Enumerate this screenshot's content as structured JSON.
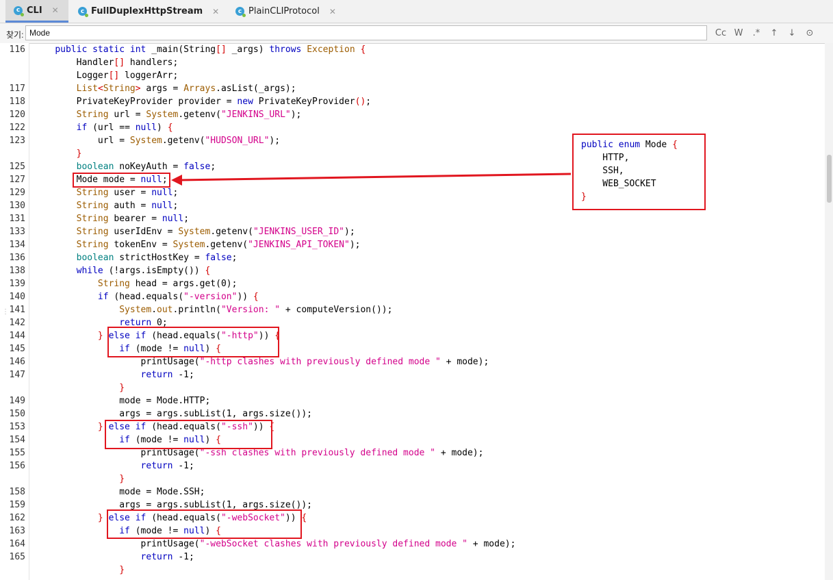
{
  "tabs": [
    {
      "label": "CLI",
      "active": true
    },
    {
      "label": "FullDuplexHttpStream",
      "active": false
    },
    {
      "label": "PlainCLIProtocol",
      "active": false
    }
  ],
  "find": {
    "label": "찾기:",
    "value": "Mode",
    "options": [
      "Cc",
      "W",
      ".*",
      "↑",
      "↓",
      "⊙"
    ]
  },
  "code_lines": [
    {
      "n": "116",
      "html": "    <span class='kw'>public static int</span> _main(String<span class='br'>[]</span> _args) <span class='kw'>throws</span> <span class='cls'>Exception</span> <span class='br'>{</span>"
    },
    {
      "n": "",
      "html": "        Handler<span class='br'>[]</span> handlers;"
    },
    {
      "n": "",
      "html": "        Logger<span class='br'>[]</span> loggerArr;"
    },
    {
      "n": "117",
      "html": "        <span class='cls'>List</span><span class='br'>&lt;</span><span class='cls'>String</span><span class='br'>&gt;</span> args = <span class='cls'>Arrays</span>.asList(_args);"
    },
    {
      "n": "118",
      "html": "        PrivateKeyProvider provider = <span class='kw'>new</span> PrivateKeyProvider<span class='br'>()</span>;"
    },
    {
      "n": "120",
      "html": "        <span class='cls'>String</span> url = <span class='cls'>System</span>.getenv(<span class='str'>\"JENKINS_URL\"</span>);"
    },
    {
      "n": "122",
      "html": "        <span class='kw'>if</span> (url == <span class='kw'>null</span>) <span class='br'>{</span>"
    },
    {
      "n": "123",
      "html": "            url = <span class='cls'>System</span>.getenv(<span class='str'>\"HUDSON_URL\"</span>);"
    },
    {
      "n": "",
      "html": "        <span class='br'>}</span>"
    },
    {
      "n": "125",
      "html": "        <span class='ty'>boolean</span> noKeyAuth = <span class='kw'>false</span>;"
    },
    {
      "n": "127",
      "html": "        Mode mode = <span class='kw'>null</span>;"
    },
    {
      "n": "129",
      "html": "        <span class='cls'>String</span> user = <span class='kw'>null</span>;"
    },
    {
      "n": "130",
      "html": "        <span class='cls'>String</span> auth = <span class='kw'>null</span>;"
    },
    {
      "n": "131",
      "html": "        <span class='cls'>String</span> bearer = <span class='kw'>null</span>;"
    },
    {
      "n": "133",
      "html": "        <span class='cls'>String</span> userIdEnv = <span class='cls'>System</span>.getenv(<span class='str'>\"JENKINS_USER_ID\"</span>);"
    },
    {
      "n": "134",
      "html": "        <span class='cls'>String</span> tokenEnv = <span class='cls'>System</span>.getenv(<span class='str'>\"JENKINS_API_TOKEN\"</span>);"
    },
    {
      "n": "136",
      "html": "        <span class='ty'>boolean</span> strictHostKey = <span class='kw'>false</span>;"
    },
    {
      "n": "138",
      "html": "        <span class='kw'>while</span> (!args.isEmpty()) <span class='br'>{</span>"
    },
    {
      "n": "139",
      "html": "            <span class='cls'>String</span> head = args.get(0);"
    },
    {
      "n": "140",
      "html": "            <span class='kw'>if</span> (head.equals(<span class='str'>\"-version\"</span>)) <span class='br'>{</span>"
    },
    {
      "n": "141",
      "html": "                <span class='cls'>System</span>.<span class='cls'>out</span>.println(<span class='str'>\"Version: \"</span> + computeVersion());"
    },
    {
      "n": "142",
      "html": "                <span class='kw'>return</span> 0;"
    },
    {
      "n": "144",
      "html": "            <span class='br'>}</span> <span class='kw'>else if</span> (head.equals(<span class='str'>\"-http\"</span>)) <span class='br'>{</span>"
    },
    {
      "n": "145",
      "html": "                <span class='kw'>if</span> (mode != <span class='kw'>null</span>) <span class='br'>{</span>"
    },
    {
      "n": "146",
      "html": "                    printUsage(<span class='str'>\"-http clashes with previously defined mode \"</span> + mode);"
    },
    {
      "n": "147",
      "html": "                    <span class='kw'>return</span> -1;"
    },
    {
      "n": "",
      "html": "                <span class='br'>}</span>"
    },
    {
      "n": "149",
      "html": "                mode = Mode.HTTP;"
    },
    {
      "n": "150",
      "html": "                args = args.subList(1, args.size());"
    },
    {
      "n": "153",
      "html": "            <span class='br'>}</span> <span class='kw'>else if</span> (head.equals(<span class='str'>\"-ssh\"</span>)) <span class='br'>{</span>"
    },
    {
      "n": "154",
      "html": "                <span class='kw'>if</span> (mode != <span class='kw'>null</span>) <span class='br'>{</span>"
    },
    {
      "n": "155",
      "html": "                    printUsage(<span class='str'>\"-ssh clashes with previously defined mode \"</span> + mode);"
    },
    {
      "n": "156",
      "html": "                    <span class='kw'>return</span> -1;"
    },
    {
      "n": "",
      "html": "                <span class='br'>}</span>"
    },
    {
      "n": "158",
      "html": "                mode = Mode.SSH;"
    },
    {
      "n": "159",
      "html": "                args = args.subList(1, args.size());"
    },
    {
      "n": "162",
      "html": "            <span class='br'>}</span> <span class='kw'>else if</span> (head.equals(<span class='str'>\"-webSocket\"</span>)) <span class='br'>{</span>"
    },
    {
      "n": "163",
      "html": "                <span class='kw'>if</span> (mode != <span class='kw'>null</span>) <span class='br'>{</span>"
    },
    {
      "n": "164",
      "html": "                    printUsage(<span class='str'>\"-webSocket clashes with previously defined mode \"</span> + mode);"
    },
    {
      "n": "165",
      "html": "                    <span class='kw'>return</span> -1;"
    },
    {
      "n": "",
      "html": "                <span class='br'>}</span>"
    }
  ],
  "callout": {
    "lines": [
      "<span class='kw'>public enum</span> Mode <span class='br'>{</span>",
      "    HTTP,",
      "    SSH,",
      "    WEB_SOCKET",
      "<span class='br'>}</span>"
    ]
  },
  "colors": {
    "highlight_box": "#e1161f",
    "keyword": "#0000c0",
    "string": "#d3008a"
  }
}
